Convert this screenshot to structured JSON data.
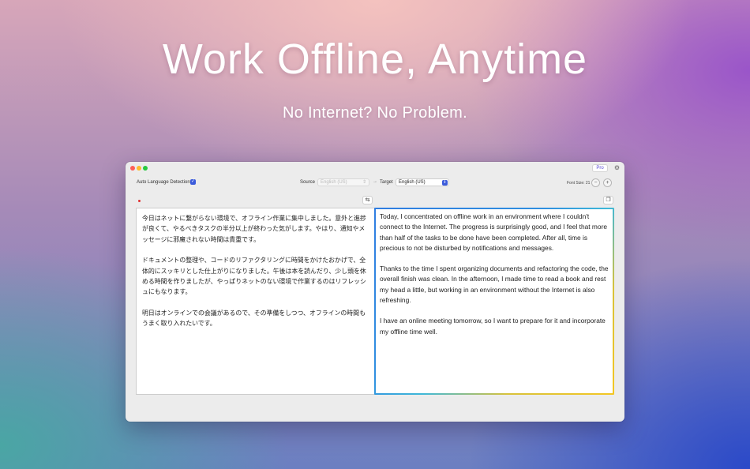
{
  "hero": {
    "headline": "Work Offline, Anytime",
    "subheadline": "No Internet? No Problem."
  },
  "window": {
    "pro_badge": "Pro",
    "toolbar": {
      "auto_detect_label": "Auto Language Detection",
      "auto_detect_checked": true,
      "source_label": "Source",
      "source_value": "English (US)",
      "target_label": "Target",
      "target_value": "English (US)",
      "font_size_label": "Font Size: 21"
    },
    "icons": {
      "gear": "gear-icon",
      "arrow": "arrow-right-icon",
      "minus": "zoom-out-icon",
      "plus": "zoom-in-icon",
      "swap": "swap-icon",
      "copy": "copy-icon"
    },
    "source_text": {
      "paragraphs": [
        "今日はネットに繋がらない環境で、オフライン作業に集中しました。意外と進捗が良くて、やるべきタスクの半分以上が終わった気がします。やはり、通知やメッセージに邪魔されない時間は貴重です。",
        "ドキュメントの整理や、コードのリファクタリングに時間をかけたおかげで、全体的にスッキリとした仕上がりになりました。午後は本を読んだり、少し頭を休める時間を作りましたが、やっぱりネットのない環境で作業するのはリフレッシュにもなります。",
        "明日はオンラインでの会議があるので、その準備をしつつ、オフラインの時間もうまく取り入れたいです。"
      ]
    },
    "target_text": {
      "paragraphs": [
        "Today, I concentrated on offline work in an environment where I couldn't connect to the Internet. The progress is surprisingly good, and I feel that more than half of the tasks to be done have been completed. After all, time is precious to not be disturbed by notifications and messages.",
        "Thanks to the time I spent organizing documents and refactoring the code, the overall finish was clean. In the afternoon, I made time to read a book and rest my head a little, but working in an environment without the Internet is also refreshing.",
        "I have an online meeting tomorrow, so I want to prepare for it and incorporate my offline time well."
      ]
    },
    "colors": {
      "accent": "#3b5bdb",
      "close": "#fe5f57",
      "minimize": "#febc2e",
      "zoom": "#28c840"
    }
  }
}
